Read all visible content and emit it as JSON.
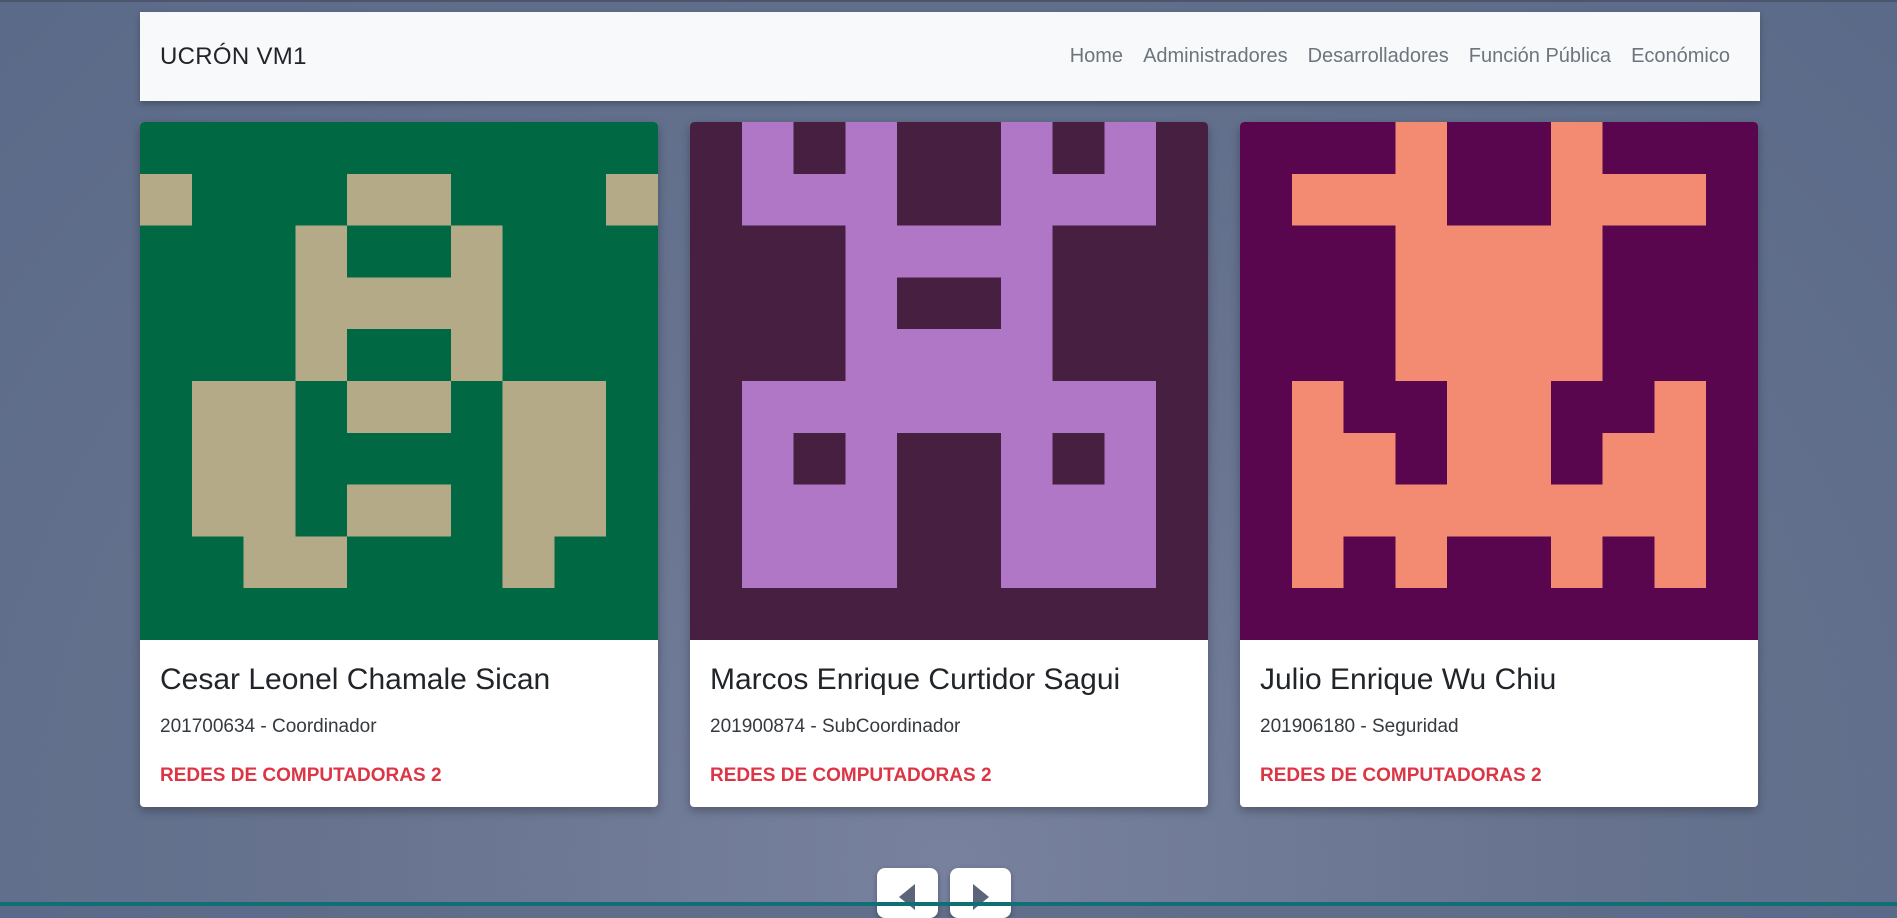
{
  "navbar": {
    "brand": "UCRÓN VM1",
    "links": [
      "Home",
      "Administradores",
      "Desarrolladores",
      "Función Pública",
      "Económico"
    ]
  },
  "cards": [
    {
      "name": "Cesar Leonel Chamale Sican",
      "subtitle": "201700634 - Coordinador",
      "course": "REDES DE COMPUTADORAS 2",
      "avatar": {
        "bg": "#006944",
        "fg": "#b5aa88",
        "grid": [
          "0000000000",
          "1000110001",
          "0001001000",
          "0001111000",
          "0001001000",
          "0110110110",
          "0110000110",
          "0110110110",
          "0011000100",
          "0000000000"
        ]
      }
    },
    {
      "name": "Marcos Enrique Curtidor Sagui",
      "subtitle": "201900874 - SubCoordinador",
      "course": "REDES DE COMPUTADORAS 2",
      "avatar": {
        "bg": "#471f41",
        "fg": "#b077c7",
        "grid": [
          "0101001010",
          "0111001110",
          "0001111000",
          "0001001000",
          "0001111000",
          "0111111110",
          "0101001010",
          "0111001110",
          "0111001110",
          "0000000000"
        ]
      }
    },
    {
      "name": "Julio Enrique Wu Chiu",
      "subtitle": "201906180 - Seguridad",
      "course": "REDES DE COMPUTADORAS 2",
      "avatar": {
        "bg": "#5a064f",
        "fg": "#f38b72",
        "grid": [
          "0001001000",
          "0111001110",
          "0001111000",
          "0001111000",
          "0001111000",
          "0100110010",
          "0110110110",
          "0111111110",
          "0101001010",
          "0000000000"
        ]
      }
    }
  ],
  "carousel": {
    "prev": "previous",
    "next": "next"
  }
}
